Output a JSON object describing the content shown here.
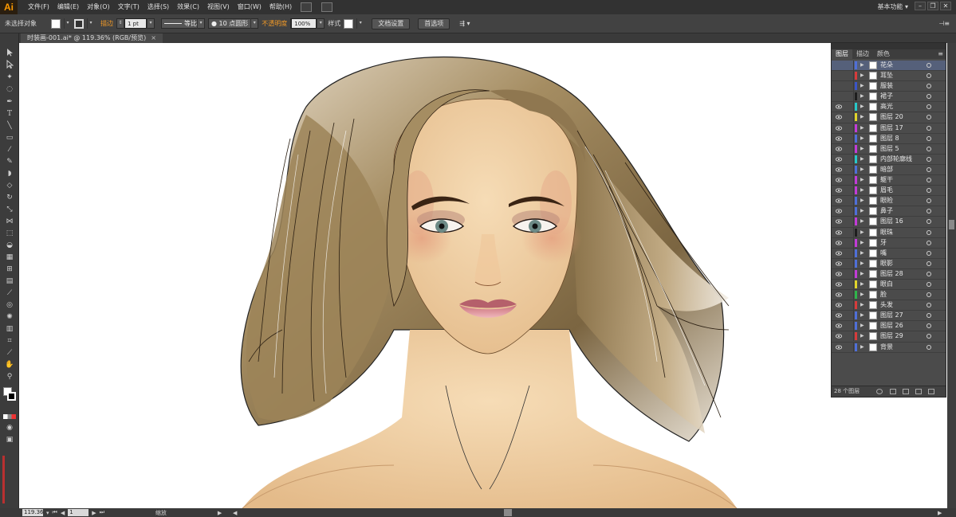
{
  "app": {
    "logo": "Ai",
    "menus": [
      "文件(F)",
      "编辑(E)",
      "对象(O)",
      "文字(T)",
      "选择(S)",
      "效果(C)",
      "视图(V)",
      "窗口(W)",
      "帮助(H)"
    ],
    "workspace": "基本功能",
    "window_controls": [
      "–",
      "❐",
      "✕"
    ]
  },
  "controlbar": {
    "selection_label": "未选择对象",
    "stroke_label": "描边",
    "stroke_weight": "1 pt",
    "stroke_profile": "等比",
    "brush": "10 点圆形",
    "opacity_label": "不透明度",
    "opacity_value": "100%",
    "style_label": "样式",
    "doc_setup_button": "文档设置",
    "preferences_button": "首选项"
  },
  "document": {
    "tab_title": "时装画-001.ai* @ 119.36% (RGB/预览)",
    "tab_close": "×"
  },
  "statusbar": {
    "zoom": "119.36",
    "artboard": "1",
    "mode": "缩放"
  },
  "layers_panel": {
    "tabs": [
      "图层",
      "描边",
      "颜色"
    ],
    "active_tab": "图层",
    "menu_icon": "≡",
    "count_label": "28 个图层",
    "layers": [
      {
        "name": "花朵",
        "color": "#4f6fd8",
        "visible": false,
        "selected": true
      },
      {
        "name": "耳坠",
        "color": "#d83b3b",
        "visible": false
      },
      {
        "name": "服装",
        "color": "#3b55c8",
        "visible": false
      },
      {
        "name": "裙子",
        "color": "#1e1e1e",
        "visible": false
      },
      {
        "name": "高光",
        "color": "#27c8c8",
        "visible": true
      },
      {
        "name": "图层 20",
        "color": "#e0d52a",
        "visible": true
      },
      {
        "name": "图层 17",
        "color": "#c23bd8",
        "visible": true
      },
      {
        "name": "图层 8",
        "color": "#4f6fd8",
        "visible": true
      },
      {
        "name": "图层 5",
        "color": "#c23bd8",
        "visible": true
      },
      {
        "name": "内部轮廓线",
        "color": "#27c8c8",
        "visible": true
      },
      {
        "name": "暗部",
        "color": "#4f6fd8",
        "visible": true
      },
      {
        "name": "躯干",
        "color": "#c23bd8",
        "visible": true
      },
      {
        "name": "眉毛",
        "color": "#c23bd8",
        "visible": true
      },
      {
        "name": "眼睑",
        "color": "#4f6fd8",
        "visible": true
      },
      {
        "name": "鼻子",
        "color": "#4f6fd8",
        "visible": true
      },
      {
        "name": "图层 16",
        "color": "#c23bd8",
        "visible": true
      },
      {
        "name": "眼珠",
        "color": "#1e1e1e",
        "visible": true
      },
      {
        "name": "牙",
        "color": "#c23bd8",
        "visible": true
      },
      {
        "name": "嘴",
        "color": "#4f6fd8",
        "visible": true
      },
      {
        "name": "眼影",
        "color": "#4f6fd8",
        "visible": true
      },
      {
        "name": "图层 28",
        "color": "#c23bd8",
        "visible": true
      },
      {
        "name": "眼白",
        "color": "#e0d52a",
        "visible": true
      },
      {
        "name": "脸",
        "color": "#2fb64a",
        "visible": true
      },
      {
        "name": "头发",
        "color": "#d83b3b",
        "visible": true
      },
      {
        "name": "图层 27",
        "color": "#4f6fd8",
        "visible": true
      },
      {
        "name": "图层 26",
        "color": "#4f6fd8",
        "visible": true
      },
      {
        "name": "图层 29",
        "color": "#d83b3b",
        "visible": true
      },
      {
        "name": "背景",
        "color": "#4f6fd8",
        "visible": true
      }
    ]
  },
  "colors": {
    "app_bg": "#535353",
    "menubar": "#323232",
    "accent_orange": "#f29a27",
    "canvas": "#ffffff"
  }
}
